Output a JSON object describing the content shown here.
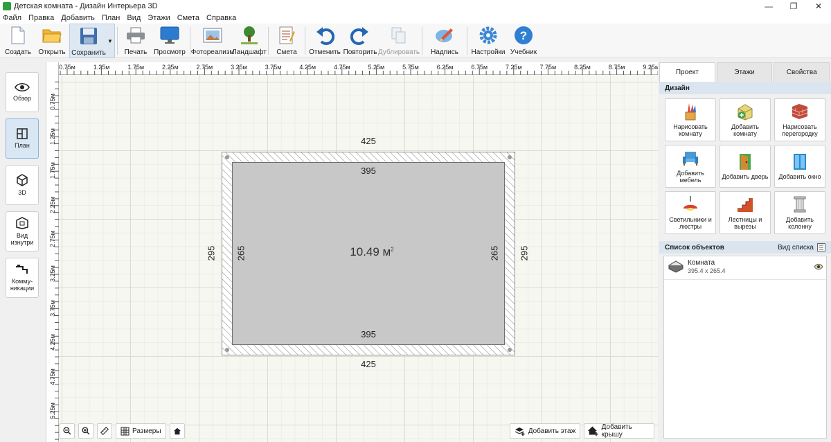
{
  "window": {
    "title": "Детская комната - Дизайн Интерьера 3D",
    "minimize": "—",
    "maximize": "❐",
    "close": "✕"
  },
  "menu": [
    "Файл",
    "Правка",
    "Добавить",
    "План",
    "Вид",
    "Этажи",
    "Смета",
    "Справка"
  ],
  "toolbar": {
    "create": "Создать",
    "open": "Открыть",
    "save": "Сохранить",
    "print": "Печать",
    "preview": "Просмотр",
    "photoreal": "Фотореализм",
    "landscape": "Ландшафт",
    "estimate": "Смета",
    "undo": "Отменить",
    "redo": "Повторить",
    "duplicate": "Дублировать",
    "caption": "Надпись",
    "settings": "Настройки",
    "tutorial": "Учебник"
  },
  "left_panel": {
    "overview": "Обзор",
    "plan": "План",
    "view3d": "3D",
    "inside": "Вид изнутри",
    "utilities": "Комму-никации"
  },
  "rulers": {
    "top": [
      "0.75м",
      "1.25м",
      "1.75м",
      "2.25м",
      "2.75м",
      "3.25м",
      "3.75м",
      "4.25м",
      "4.75м",
      "5.25м",
      "5.75м",
      "6.25м",
      "6.75м",
      "7.25м",
      "7.75м",
      "8.25м",
      "8.75м",
      "9.25м"
    ],
    "left": [
      "0.75м",
      "1.25м",
      "1.75м",
      "2.25м",
      "2.75м",
      "3.25м",
      "3.75м",
      "4.25м",
      "4.75м",
      "5.25м"
    ]
  },
  "room": {
    "outer_top": "425",
    "outer_bottom": "425",
    "inner_top": "395",
    "inner_bottom": "395",
    "outer_left": "295",
    "outer_right": "295",
    "inner_left": "265",
    "inner_right": "265",
    "area": "10.49 м",
    "area_sup": "2"
  },
  "canvas_tools": {
    "dimensions": "Размеры",
    "add_floor": "Добавить этаж",
    "add_roof": "Добавить крышу"
  },
  "right_panel": {
    "tabs": [
      "Проект",
      "Этажи",
      "Свойства"
    ],
    "design_header": "Дизайн",
    "tools": [
      "Нарисовать комнату",
      "Добавить комнату",
      "Нарисовать перегородку",
      "Добавить мебель",
      "Добавить дверь",
      "Добавить окно",
      "Светильники и люстры",
      "Лестницы и вырезы",
      "Добавить колонну"
    ],
    "objects_header": "Список объектов",
    "list_view": "Вид списка",
    "objects": [
      {
        "name": "Комната",
        "dims": "395.4 x 265.4"
      }
    ]
  },
  "colors": {
    "room_fill": "#c8c8c8",
    "wall_hatch": "#9a9a9a",
    "active_tab": "#d9e7f5",
    "section_head": "#dbe5f0"
  }
}
